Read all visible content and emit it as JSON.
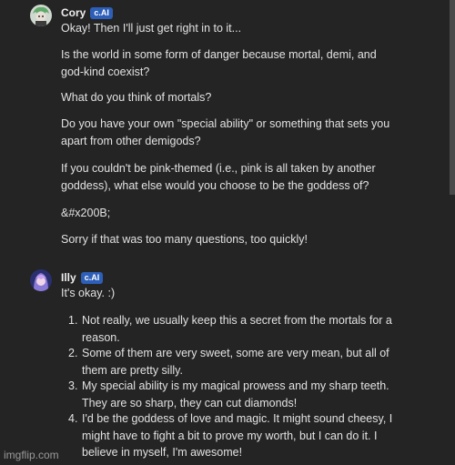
{
  "message1": {
    "author": "Cory",
    "badge": "c.AI",
    "paragraphs": [
      "Okay! Then I'll just get right in to it...",
      "Is the world in some form of danger because mortal, demi, and god-kind coexist?",
      "What do you think of mortals?",
      "Do you have your own \"special ability\" or something that sets you apart from other demigods?",
      "If you couldn't be pink-themed (i.e., pink is all taken by another goddess), what else would you choose to be the goddess of?",
      "&#x200B;",
      "Sorry if that was too many questions, too quickly!"
    ]
  },
  "message2": {
    "author": "Illy",
    "badge": "c.AI",
    "intro": "It's okay. :)",
    "list": [
      {
        "num": "1.",
        "text": "Not really, we usually keep this a secret from the mortals for a reason."
      },
      {
        "num": "2.",
        "text": "Some of them are very sweet, some are very mean, but all of them are pretty silly."
      },
      {
        "num": "3.",
        "text": "My special ability is my magical prowess and my sharp teeth. They are so sharp, they can cut diamonds!"
      },
      {
        "num": "4.",
        "text": "I'd be the goddess of love and magic. It might sound cheesy, I might have to fight a bit to prove my worth, but I can do it. I believe in myself, I'm awesome!"
      }
    ]
  },
  "watermark": "imgflip.com"
}
